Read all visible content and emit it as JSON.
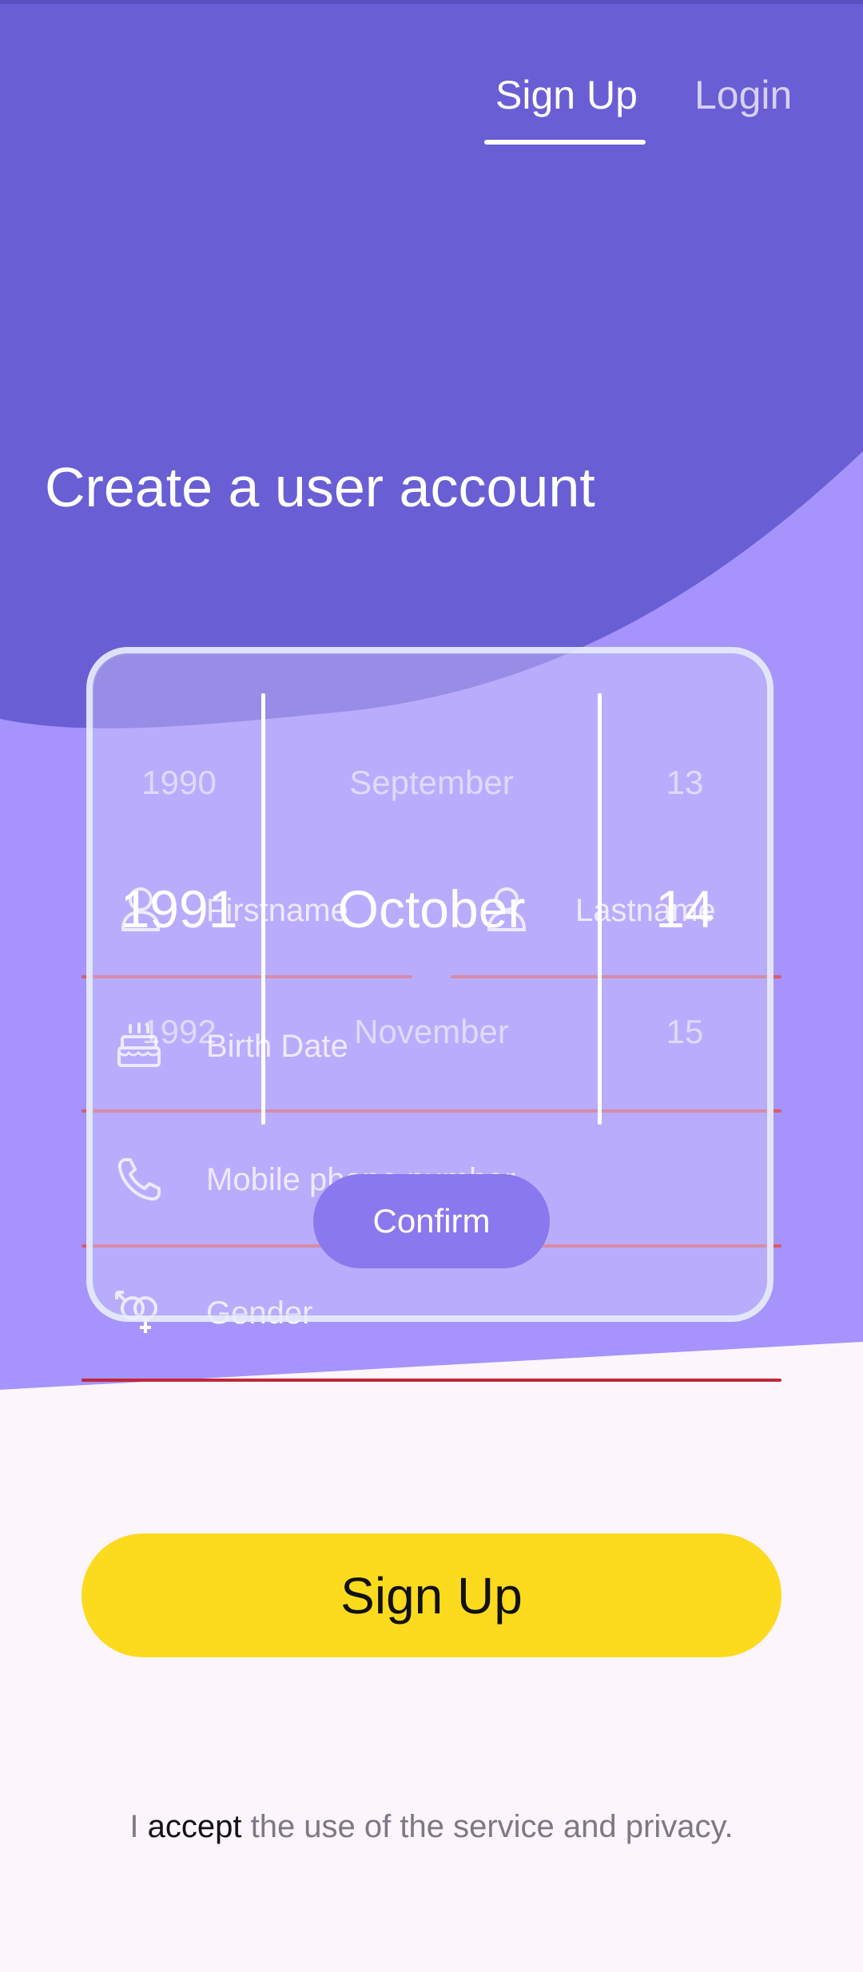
{
  "nav": {
    "signup_tab": "Sign Up",
    "login_tab": "Login"
  },
  "page_title": "Create a user account",
  "form": {
    "firstname": "Firstname",
    "lastname": "Lastname",
    "birth_date": "Birth Date",
    "mobile": "Mobile phone number",
    "gender": "Gender"
  },
  "date_picker": {
    "year_prev": "1990",
    "year_selected": "1991",
    "year_next": "1992",
    "month_prev": "September",
    "month_selected": "October",
    "month_next": "November",
    "day_prev": "13",
    "day_selected": "14",
    "day_next": "15",
    "confirm_label": "Confirm"
  },
  "signup_button": "Sign Up",
  "terms": {
    "prefix": "I ",
    "accept": "accept",
    "suffix": " the use of the service and privacy."
  },
  "colors": {
    "header_purple": "#6A5ED4",
    "mid_purple": "#A694FC",
    "background": "#FCF5FB",
    "accent_yellow": "#FCDA1E",
    "line_red": "#D65E66"
  },
  "icons": [
    "user-icon",
    "user-icon",
    "cake-icon",
    "phone-icon",
    "gender-icon"
  ]
}
